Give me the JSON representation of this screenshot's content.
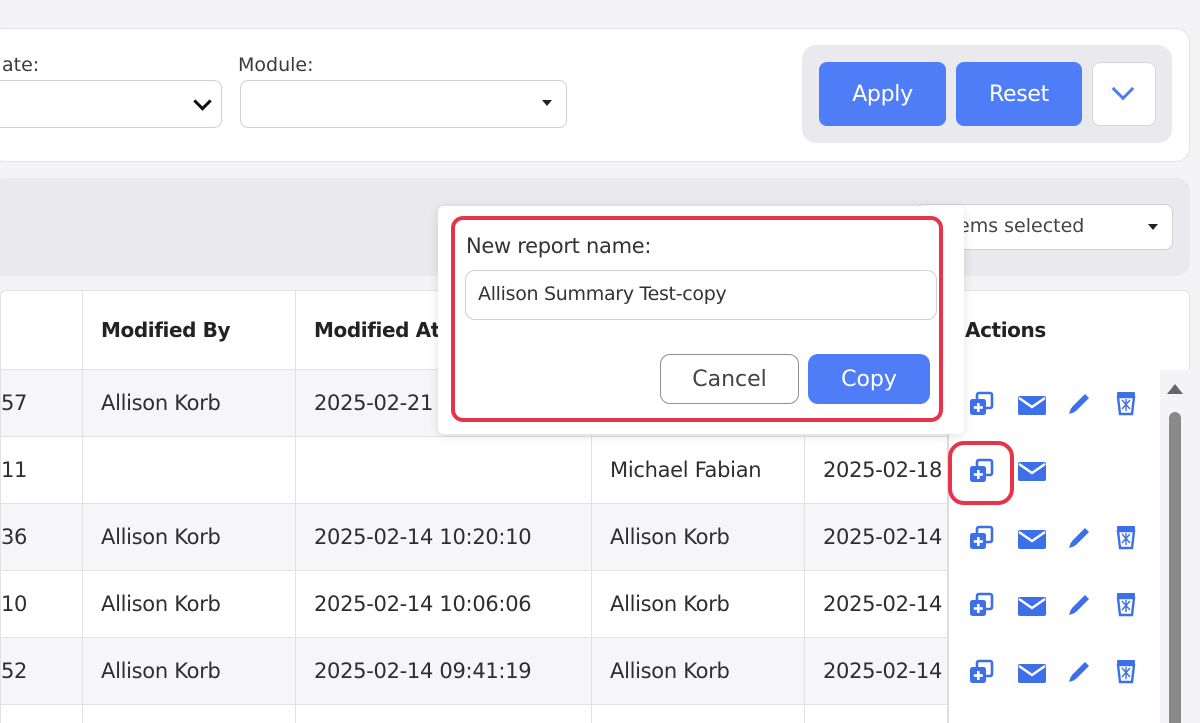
{
  "filters": {
    "date_label": "ate:",
    "module_label": "Module:",
    "module_value": ""
  },
  "buttons": {
    "apply": "Apply",
    "reset": "Reset"
  },
  "toolbar": {
    "items_selected": "ems selected"
  },
  "table": {
    "headers": {
      "modified_by": "Modified By",
      "modified_at": "Modified At",
      "actions": "Actions"
    },
    "rows": [
      {
        "id_tail": "57",
        "modified_by": "Allison Korb",
        "modified_at": "2025-02-21",
        "created_by": "",
        "created_at": ""
      },
      {
        "id_tail": "11",
        "modified_by": "",
        "modified_at": "",
        "created_by": "Michael Fabian",
        "created_at": "2025-02-18"
      },
      {
        "id_tail": "36",
        "modified_by": "Allison Korb",
        "modified_at": "2025-02-14 10:20:10",
        "created_by": "Allison Korb",
        "created_at": "2025-02-14"
      },
      {
        "id_tail": "10",
        "modified_by": "Allison Korb",
        "modified_at": "2025-02-14 10:06:06",
        "created_by": "Allison Korb",
        "created_at": "2025-02-14"
      },
      {
        "id_tail": "52",
        "modified_by": "Allison Korb",
        "modified_at": "2025-02-14 09:41:19",
        "created_by": "Allison Korb",
        "created_at": "2025-02-14"
      }
    ]
  },
  "popup": {
    "label": "New report name:",
    "input_value": "Allison Summary Test-copy",
    "cancel": "Cancel",
    "copy": "Copy"
  },
  "colors": {
    "accent": "#4f7df7",
    "highlight": "#e8334a"
  },
  "icons": [
    "copy-icon",
    "email-icon",
    "edit-icon",
    "delete-icon",
    "chevron-down-icon"
  ]
}
